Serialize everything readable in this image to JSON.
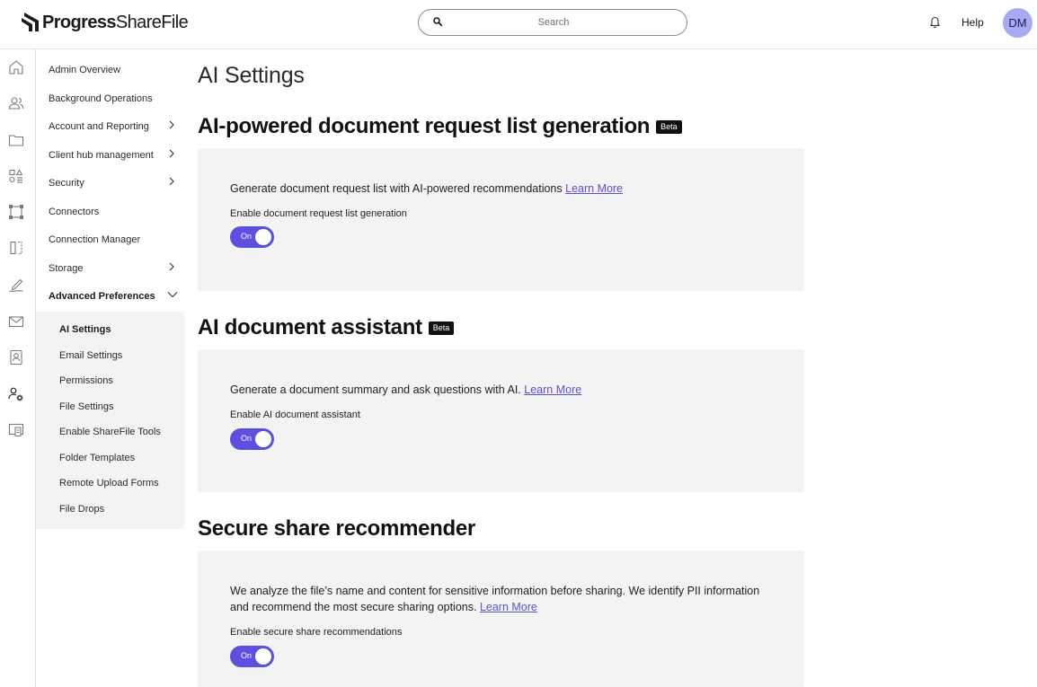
{
  "header": {
    "brand_bold": "Progress",
    "brand_light": "ShareFile",
    "search_placeholder": "Search",
    "help_label": "Help",
    "avatar_initials": "DM"
  },
  "rail_icons": [
    "home-icon",
    "users-icon",
    "folder-icon",
    "apps-icon",
    "workflows-icon",
    "compare-icon",
    "signature-icon",
    "mail-icon",
    "contacts-icon",
    "admin-settings-icon",
    "client-portal-icon"
  ],
  "sidebar": {
    "items": [
      {
        "label": "Admin Overview",
        "chevron": false
      },
      {
        "label": "Background Operations",
        "chevron": false
      },
      {
        "label": "Account and Reporting",
        "chevron": true
      },
      {
        "label": "Client hub management",
        "chevron": true
      },
      {
        "label": "Security",
        "chevron": true
      },
      {
        "label": "Connectors",
        "chevron": false
      },
      {
        "label": "Connection Manager",
        "chevron": false
      },
      {
        "label": "Storage",
        "chevron": true
      },
      {
        "label": "Advanced Preferences",
        "chevron": true,
        "expanded": true
      }
    ],
    "sub_items": [
      {
        "label": "AI Settings",
        "active": true
      },
      {
        "label": "Email Settings"
      },
      {
        "label": "Permissions"
      },
      {
        "label": "File Settings"
      },
      {
        "label": "Enable ShareFile Tools"
      },
      {
        "label": "Folder Templates"
      },
      {
        "label": "Remote Upload Forms"
      },
      {
        "label": "File Drops"
      }
    ]
  },
  "main": {
    "page_title": "AI Settings",
    "sections": [
      {
        "title": "AI-powered document request list generation",
        "badge": "Beta",
        "description": "Generate document request list with AI-powered recommendations",
        "link": "Learn More",
        "toggle_label": "Enable document request list generation",
        "toggle_state": "On"
      },
      {
        "title": "AI document assistant",
        "badge": "Beta",
        "description": "Generate a document summary and ask questions with AI.",
        "link": "Learn More",
        "toggle_label": "Enable AI document assistant",
        "toggle_state": "On"
      },
      {
        "title": "Secure share recommender",
        "description": "We analyze the file’s name and content for sensitive information before sharing. We identify PII information and recommend the most secure sharing options.",
        "link": "Learn More",
        "toggle_label": "Enable secure share recommendations",
        "toggle_state": "On"
      }
    ]
  },
  "colors": {
    "accent": "#5b50e0",
    "link": "#5a52d5",
    "avatar_bg": "#a7a9f3",
    "card_bg": "#f3f3f3"
  }
}
